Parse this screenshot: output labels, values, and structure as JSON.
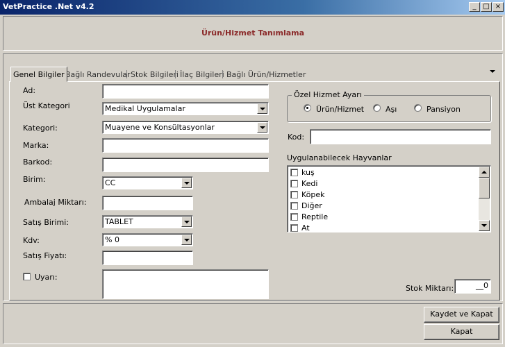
{
  "window": {
    "title": "VetPractice .Net v4.2",
    "controls": [
      "_",
      "□",
      "×"
    ]
  },
  "header": {
    "title": "Ürün/Hizmet Tanımlama"
  },
  "tabs": [
    {
      "label": "Genel Bilgiler",
      "active": true
    },
    {
      "label": "Bağlı Randevular",
      "active": false
    },
    {
      "label": "Stok Bilgileri",
      "active": false
    },
    {
      "label": "İlaç Bilgileri",
      "active": false
    },
    {
      "label": "Bağlı Ürün/Hizmetler",
      "active": false
    }
  ],
  "form": {
    "ad": {
      "label": "Ad:",
      "value": ""
    },
    "ust_kategori": {
      "label": "Üst Kategori",
      "value": "Medikal Uygulamalar"
    },
    "kategori": {
      "label": "Kategori:",
      "value": "Muayene ve Konsültasyonlar"
    },
    "marka": {
      "label": "Marka:",
      "value": ""
    },
    "barkod": {
      "label": "Barkod:",
      "value": ""
    },
    "birim": {
      "label": "Birim:",
      "value": "CC"
    },
    "ambalaj": {
      "label": "Ambalaj Miktarı:",
      "value": ""
    },
    "satis_birimi": {
      "label": "Satış Birimi:",
      "value": "TABLET"
    },
    "kdv": {
      "label": "Kdv:",
      "value": "% 0"
    },
    "satis_fiyati": {
      "label": "Satış Fiyatı:",
      "value": ""
    },
    "uyari": {
      "label": "Uyarı:",
      "checked": false,
      "value": ""
    }
  },
  "ozel_hizmet": {
    "label": "Özel Hizmet Ayarı",
    "options": [
      {
        "label": "Ürün/Hizmet",
        "selected": true
      },
      {
        "label": "Aşı",
        "selected": false
      },
      {
        "label": "Pansiyon",
        "selected": false
      }
    ]
  },
  "kod": {
    "label": "Kod:",
    "value": ""
  },
  "hayvanlar": {
    "label": "Uygulanabilecek Hayvanlar",
    "items": [
      "kuş",
      "Kedi",
      "Köpek",
      "Diğer",
      "Reptile",
      "At"
    ]
  },
  "stok": {
    "label": "Stok Miktarı:",
    "value": "__0"
  },
  "buttons": {
    "save_close": "Kaydet ve Kapat",
    "close": "Kapat"
  }
}
